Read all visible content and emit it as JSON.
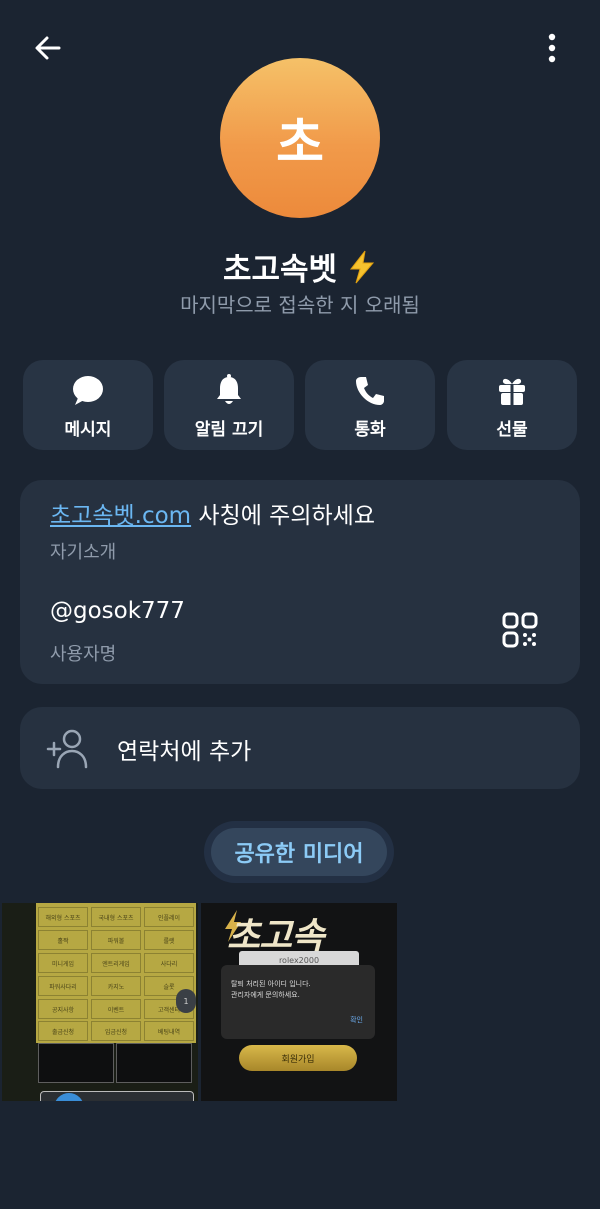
{
  "profile": {
    "avatar_initial": "초",
    "name": "초고속벳",
    "status": "마지막으로 접속한 지 오래됨"
  },
  "actions": [
    {
      "label": "메시지",
      "icon": "chat-bubble-icon"
    },
    {
      "label": "알림 끄기",
      "icon": "bell-icon"
    },
    {
      "label": "통화",
      "icon": "phone-icon"
    },
    {
      "label": "선물",
      "icon": "gift-icon"
    }
  ],
  "info": {
    "bio_link": "초고속벳.com",
    "bio_rest": " 사칭에 주의하세요",
    "bio_caption": "자기소개",
    "username": "@gosok777",
    "username_caption": "사용자명"
  },
  "contact": {
    "add_label": "연락처에 추가"
  },
  "media": {
    "tab_label": "공유한 미디어",
    "thumb1": {
      "cells": [
        "해외형 스포츠",
        "국내형 스포츠",
        "인플레이",
        "홀짝",
        "파워볼",
        "룰렛",
        "미니게임",
        "엔트리게임",
        "사다리",
        "파워사다리",
        "카지노",
        "슬롯",
        "공지사항",
        "이벤트",
        "고객센터",
        "출금신청",
        "입금신청",
        "베팅내역"
      ],
      "badge": "1"
    },
    "thumb2": {
      "logo": "초고속",
      "login_value": "rolex2000",
      "dialog_line1": "탈퇴 처리된 아이디 입니다.",
      "dialog_line2": "관리자에게 문의하세요.",
      "dialog_ok": "확인",
      "join_label": "회원가입"
    }
  },
  "colors": {
    "background": "#1b2431",
    "card": "#263140",
    "action_button": "#283444",
    "muted_text": "#8f9bab",
    "link": "#6bb7f2",
    "avatar_gradient_top": "#f5c168",
    "avatar_gradient_bottom": "#ec8a3b"
  }
}
